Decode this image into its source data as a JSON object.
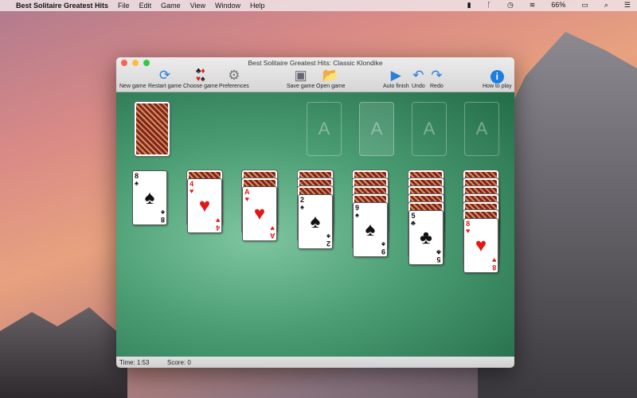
{
  "menubar": {
    "apple": "",
    "app": "Best Solitaire Greatest Hits",
    "items": [
      "File",
      "Edit",
      "Game",
      "View",
      "Window",
      "Help"
    ],
    "battery": "66%"
  },
  "window": {
    "title": "Best Solitaire Greatest Hits: Classic Klondike"
  },
  "toolbar": {
    "new_game": "New game",
    "restart_game": "Restart game",
    "choose_game": "Choose game",
    "preferences": "Preferences",
    "save_game": "Save game",
    "open_game": "Open game",
    "auto_finish": "Auto finish",
    "undo": "Undo",
    "redo": "Redo",
    "how_to_play": "How to play"
  },
  "foundations": [
    "A",
    "A",
    "A",
    "A"
  ],
  "tableau": [
    {
      "hidden": 0,
      "rank": "8",
      "suit": "♠",
      "color": "blk"
    },
    {
      "hidden": 1,
      "rank": "4",
      "suit": "♥",
      "color": "red"
    },
    {
      "hidden": 2,
      "rank": "A",
      "suit": "♥",
      "color": "red"
    },
    {
      "hidden": 3,
      "rank": "2",
      "suit": "♠",
      "color": "blk"
    },
    {
      "hidden": 4,
      "rank": "9",
      "suit": "♠",
      "color": "blk"
    },
    {
      "hidden": 5,
      "rank": "5",
      "suit": "♣",
      "color": "blk"
    },
    {
      "hidden": 6,
      "rank": "8",
      "suit": "♥",
      "color": "red"
    }
  ],
  "status": {
    "time": "Time: 1:53",
    "score": "Score: 0"
  }
}
